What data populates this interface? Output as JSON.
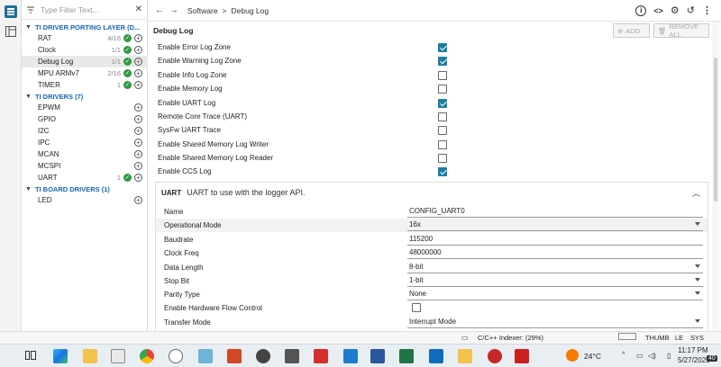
{
  "filter": {
    "placeholder": "Type Filter Text..."
  },
  "sidebar": {
    "groups": [
      {
        "label": "TI DRIVER PORTING LAYER (D...",
        "items": [
          {
            "name": "RAT",
            "count": "4/16",
            "checked": true
          },
          {
            "name": "Clock",
            "count": "1/1",
            "checked": true
          },
          {
            "name": "Debug Log",
            "count": "1/1",
            "checked": true
          },
          {
            "name": "MPU ARMv7",
            "count": "2/16",
            "checked": true
          },
          {
            "name": "TIMER",
            "count": "1",
            "checked": true
          }
        ]
      },
      {
        "label": "TI DRIVERS (7)",
        "items": [
          {
            "name": "EPWM",
            "count": "",
            "checked": false
          },
          {
            "name": "GPIO",
            "count": "",
            "checked": false
          },
          {
            "name": "I2C",
            "count": "",
            "checked": false
          },
          {
            "name": "IPC",
            "count": "",
            "checked": false
          },
          {
            "name": "MCAN",
            "count": "",
            "checked": false
          },
          {
            "name": "MCSPI",
            "count": "",
            "checked": false
          },
          {
            "name": "UART",
            "count": "1",
            "checked": true
          }
        ]
      },
      {
        "label": "TI BOARD DRIVERS (1)",
        "items": [
          {
            "name": "LED",
            "count": "",
            "checked": false
          }
        ]
      }
    ]
  },
  "breadcrumb": {
    "part1": "Software",
    "sep": ">",
    "part2": "Debug Log"
  },
  "main": {
    "title": "Debug Log",
    "add_label": "ADD",
    "remove_all_label": "REMOVE ALL",
    "options": [
      {
        "label": "Enable Error Log Zone",
        "checked": true
      },
      {
        "label": "Enable Warning Log Zone",
        "checked": true
      },
      {
        "label": "Enable Info Log Zone",
        "checked": false
      },
      {
        "label": "Enable Memory Log",
        "checked": false
      },
      {
        "label": "Enable UART Log",
        "checked": true
      },
      {
        "label": "Remote Core Trace (UART)",
        "checked": false
      },
      {
        "label": "SysFw UART Trace",
        "checked": false
      },
      {
        "label": "Enable Shared Memory Log Writer",
        "checked": false
      },
      {
        "label": "Enable Shared Memory Log Reader",
        "checked": false
      },
      {
        "label": "Enable CCS Log",
        "checked": true
      }
    ],
    "uart_panel": {
      "tag": "UART",
      "description": "UART to use with the logger API.",
      "fields": [
        {
          "label": "Name",
          "value": "CONFIG_UART0",
          "dropdown": false,
          "checkbox": false
        },
        {
          "label": "Operational Mode",
          "value": "16x",
          "dropdown": true,
          "checkbox": false
        },
        {
          "label": "Baudrate",
          "value": "115200",
          "dropdown": false,
          "checkbox": false
        },
        {
          "label": "Clock Freq",
          "value": "48000000",
          "dropdown": false,
          "checkbox": false
        },
        {
          "label": "Data Length",
          "value": "8-bit",
          "dropdown": true,
          "checkbox": false
        },
        {
          "label": "Stop Bit",
          "value": "1-bit",
          "dropdown": true,
          "checkbox": false
        },
        {
          "label": "Parity Type",
          "value": "None",
          "dropdown": true,
          "checkbox": false
        },
        {
          "label": "Enable Hardware Flow Control",
          "value": "",
          "dropdown": false,
          "checkbox": true
        },
        {
          "label": "Transfer Mode",
          "value": "Interrupt Mode",
          "dropdown": true,
          "checkbox": false
        }
      ]
    }
  },
  "statusbar": {
    "indexer": "C/C++ Indexer: (29%)",
    "thumb": "THUMB",
    "le": "LE",
    "sys": "SYS"
  },
  "taskbar": {
    "temperature": "24°C",
    "time": "11:17 PM",
    "date": "5/27/2025",
    "notifications": "40"
  },
  "colors": {
    "accent": "#1b7ea2",
    "group_header": "#1565c0",
    "check_green": "#2e9a44"
  }
}
